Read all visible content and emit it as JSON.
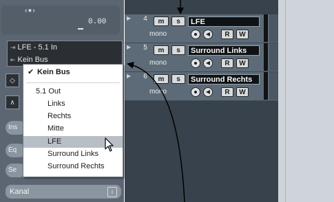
{
  "inspector": {
    "pan_value": "0.00",
    "routing": {
      "input_label": "LFE - 5.1 In",
      "output_label": "Kein Bus"
    },
    "sections": [
      {
        "label": "Ins"
      },
      {
        "label": "Eq"
      },
      {
        "label": "Se"
      }
    ],
    "channel_label": "Kanal"
  },
  "tracks": [
    {
      "number": "4",
      "name": "LFE",
      "mode": "mono",
      "mute": "m",
      "solo": "s",
      "read": "R",
      "write": "W"
    },
    {
      "number": "5",
      "name": "Surround Links",
      "mode": "mono",
      "mute": "m",
      "solo": "s",
      "read": "R",
      "write": "W"
    },
    {
      "number": "6",
      "name": "Surround Rechts",
      "mode": "mono",
      "mute": "m",
      "solo": "s",
      "read": "R",
      "write": "W"
    }
  ],
  "menu": {
    "checked_item": "Kein Bus",
    "group_label": "5.1 Out",
    "items": [
      {
        "label": "Links"
      },
      {
        "label": "Rechts"
      },
      {
        "label": "Mitte"
      },
      {
        "label": "LFE",
        "highlighted": true
      },
      {
        "label": "Surround Links"
      },
      {
        "label": "Surround Rechts"
      }
    ]
  },
  "colors": {
    "inspector_bg": "#5b6672",
    "track_bg": "#5d6b78",
    "menu_highlight": "#b8bec6",
    "grid_bg": "#ced4d9"
  },
  "icons": [
    "pan-icon",
    "input-routing-icon",
    "output-routing-icon",
    "fold-arrow-icon",
    "record-enable-icon",
    "monitor-speaker-icon",
    "mouse-cursor-icon",
    "checkmark-icon"
  ]
}
